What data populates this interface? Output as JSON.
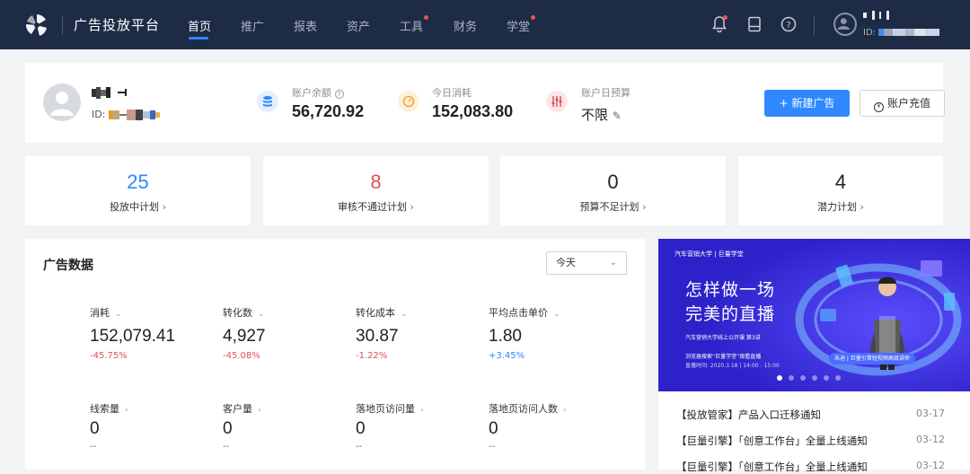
{
  "app": {
    "brand": "广告投放平台"
  },
  "nav": [
    {
      "label": "首页",
      "active": true
    },
    {
      "label": "推广"
    },
    {
      "label": "报表"
    },
    {
      "label": "资产"
    },
    {
      "label": "工具",
      "dot": true
    },
    {
      "label": "财务"
    },
    {
      "label": "学堂",
      "dot": true
    }
  ],
  "top_user": {
    "name": "\"▒ ' ▒",
    "id_label": "ID:"
  },
  "account": {
    "name": "▒▒▒ ┐",
    "id_label": "ID:",
    "balance": {
      "label": "账户余额",
      "value": "56,720.92"
    },
    "today_spend": {
      "label": "今日消耗",
      "value": "152,083.80"
    },
    "daily_budget": {
      "label": "账户日预算",
      "value": "不限"
    },
    "new_ad_button": "+ 新建广告",
    "recharge_button": "账户充值"
  },
  "plans": [
    {
      "value": "25",
      "label": "投放中计划",
      "color": "#2f88ff"
    },
    {
      "value": "8",
      "label": "审核不通过计划",
      "color": "#e05252"
    },
    {
      "value": "0",
      "label": "预算不足计划",
      "color": "#222222"
    },
    {
      "value": "4",
      "label": "潜力计划",
      "color": "#222222"
    }
  ],
  "ad_data": {
    "title": "广告数据",
    "range": "今天",
    "metrics_row1": [
      {
        "label": "消耗",
        "value": "152,079.41",
        "change": "-45.75%",
        "trend": "neg"
      },
      {
        "label": "转化数",
        "value": "4,927",
        "change": "-45.08%",
        "trend": "neg"
      },
      {
        "label": "转化成本",
        "value": "30.87",
        "change": "-1.22%",
        "trend": "neg"
      },
      {
        "label": "平均点击单价",
        "value": "1.80",
        "change": "+3.45%",
        "trend": "pos"
      }
    ],
    "metrics_row2": [
      {
        "label": "线索量",
        "value": "0",
        "change": "--"
      },
      {
        "label": "客户量",
        "value": "0",
        "change": "--"
      },
      {
        "label": "落地页访问量",
        "value": "0",
        "change": "--"
      },
      {
        "label": "落地页访问人数",
        "value": "0",
        "change": "--"
      }
    ]
  },
  "banner": {
    "top_text": "汽车营销大学 | 巨量学堂",
    "title_line1": "怎样做一场",
    "title_line2": "完美的直播",
    "subtitle": "汽车营销大学线上公开课 第3讲",
    "cta": "浏览器搜索“巨量学堂”观看直播",
    "time": "直播时间: 2020.3.18 | 14:00 - 15:00",
    "tag": "朱迪 | 巨量引擎短视频高级讲师"
  },
  "notices": [
    {
      "title": "【投放管家】产品入口迁移通知",
      "date": "03-17"
    },
    {
      "title": "【巨量引擎】「创意工作台」全量上线通知",
      "date": "03-12"
    },
    {
      "title": "【巨量引擎】「创意工作台」全量上线通知",
      "date": "03-12"
    }
  ]
}
